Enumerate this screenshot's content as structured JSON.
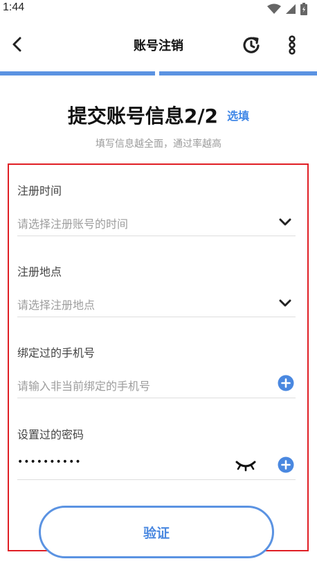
{
  "status_bar": {
    "time": "1:44"
  },
  "app_bar": {
    "title": "账号注销"
  },
  "heading": {
    "title": "提交账号信息2/2",
    "tag": "选填"
  },
  "subtitle": "填写信息越全面，通过率越高",
  "form": {
    "register_time": {
      "label": "注册时间",
      "placeholder": "请选择注册账号的时间"
    },
    "register_place": {
      "label": "注册地点",
      "placeholder": "请选择注册地点"
    },
    "bound_phone": {
      "label": "绑定过的手机号",
      "placeholder": "请输入非当前绑定的手机号"
    },
    "password": {
      "label": "设置过的密码",
      "value": "••••••••••"
    }
  },
  "verify_button": {
    "label": "验证"
  },
  "colors": {
    "accent": "#5b93e2",
    "highlight": "#e01e24",
    "placeholder": "#9d9d9d"
  }
}
